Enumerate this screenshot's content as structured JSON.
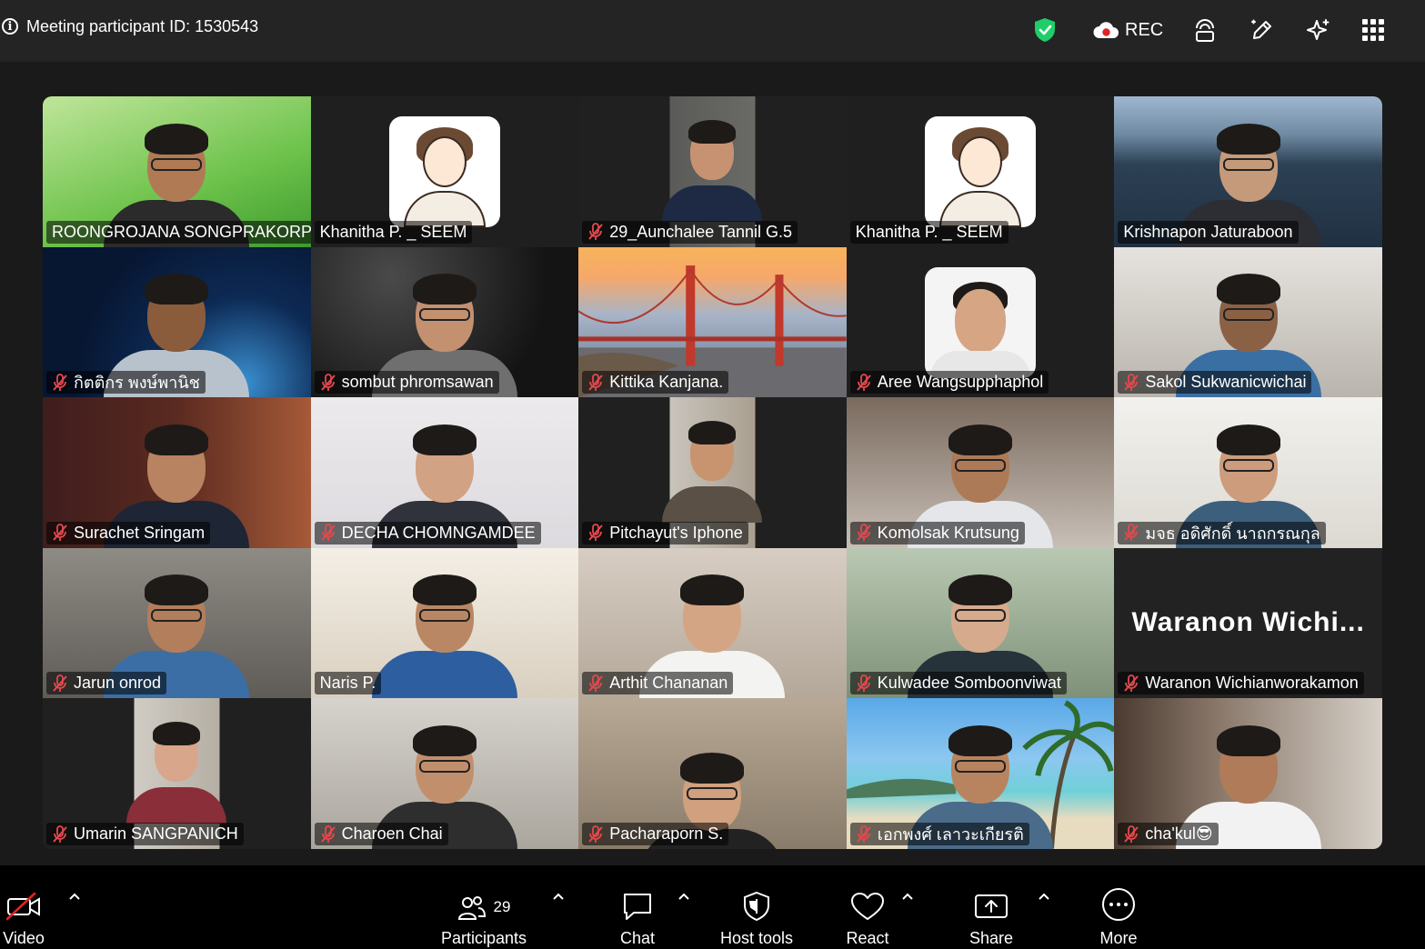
{
  "topbar": {
    "meeting_info": "Meeting participant ID: 1530543",
    "rec_label": "REC",
    "icons": [
      "info-icon",
      "security-shield-icon",
      "cloud-record-icon",
      "hybrid-icon",
      "edit-icon",
      "sparkle-icon",
      "apps-grid-icon"
    ],
    "shield_color": "#1fce6a",
    "rec_dot_color": "#e02424"
  },
  "gallery": {
    "tiles": [
      {
        "name": "ROONGROJANA SONGPRAKORP",
        "muted": false
      },
      {
        "name": "Khanitha P. _ SEEM",
        "muted": false
      },
      {
        "name": "29_Aunchalee Tannil G.5",
        "muted": true
      },
      {
        "name": "Khanitha P. _ SEEM",
        "muted": false,
        "active_speaker": true
      },
      {
        "name": "Krishnapon Jaturaboon",
        "muted": false
      },
      {
        "name": "กิตติกร พงษ์พานิช",
        "muted": true
      },
      {
        "name": "sombut phromsawan",
        "muted": true
      },
      {
        "name": "Kittika Kanjana.",
        "muted": true
      },
      {
        "name": "Aree Wangsupphaphol",
        "muted": true
      },
      {
        "name": "Sakol Sukwanicwichai",
        "muted": true
      },
      {
        "name": "Surachet Sringam",
        "muted": true
      },
      {
        "name": "DECHA CHOMNGAMDEE",
        "muted": true
      },
      {
        "name": "Pitchayut's Iphone",
        "muted": true
      },
      {
        "name": "Komolsak Krutsung",
        "muted": true
      },
      {
        "name": "มจธ อดิศักดิ์ นาถกรณกุล",
        "muted": true
      },
      {
        "name": "Jarun onrod",
        "muted": true
      },
      {
        "name": "Naris P.",
        "muted": false
      },
      {
        "name": "Arthit Chananan",
        "muted": true
      },
      {
        "name": "Kulwadee Somboonviwat",
        "muted": true
      },
      {
        "name": "Waranon Wichianworakamon",
        "muted": true,
        "big_label": "Waranon  Wichi..."
      },
      {
        "name": "Umarin SANGPANICH",
        "muted": true
      },
      {
        "name": "Charoen Chai",
        "muted": true
      },
      {
        "name": "Pacharaporn S.",
        "muted": true
      },
      {
        "name": "เอกพงศ์ เลาวะเกียรติ",
        "muted": true
      },
      {
        "name": "cha'kul😎",
        "muted": true
      }
    ],
    "active_outline_color": "#2ed37d"
  },
  "toolbar": {
    "video_label": "Video",
    "participants_label": "Participants",
    "participants_count": "29",
    "chat_label": "Chat",
    "host_tools_label": "Host tools",
    "react_label": "React",
    "share_label": "Share",
    "more_label": "More",
    "video_off_color": "#e02424"
  }
}
